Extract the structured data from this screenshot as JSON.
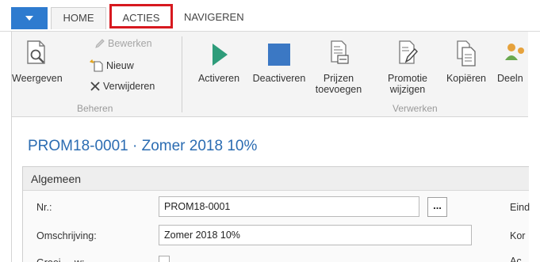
{
  "tabs": {
    "home": "HOME",
    "acties": "ACTIES",
    "navigeren": "NAVIGEREN"
  },
  "ribbon": {
    "beheren": {
      "label": "Beheren",
      "weergeven": "Weergeven",
      "bewerken": "Bewerken",
      "nieuw": "Nieuw",
      "verwijderen": "Verwijderen"
    },
    "verwerken": {
      "label": "Verwerken",
      "activeren": "Activeren",
      "deactiveren": "Deactiveren",
      "prijzen_line1": "Prijzen",
      "prijzen_line2": "toevoegen",
      "promotie_line1": "Promotie",
      "promotie_line2": "wijzigen",
      "kopieren": "Kopiëren",
      "deeln": "Deeln"
    }
  },
  "page": {
    "title": "PROM18-0001 · Zomer 2018 10%",
    "section": "Algemeen",
    "fields": {
      "nr_label": "Nr.:",
      "nr_value": "PROM18-0001",
      "dots": "...",
      "omschrijving_label": "Omschrijving:",
      "omschrijving_value": "Zomer 2018 10%",
      "partial_label": "Groei ... w:"
    },
    "right_labels": {
      "eind": "Eind",
      "kor": "Kor",
      "ac": "Ac"
    }
  },
  "colors": {
    "accent": "#2e7bcf",
    "title": "#2b6cb2",
    "highlight": "#d7191f",
    "play": "#2e9c7a",
    "stop": "#3b78c4"
  }
}
